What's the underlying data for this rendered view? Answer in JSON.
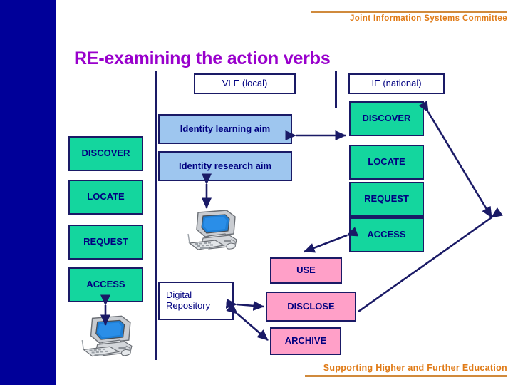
{
  "header": {
    "org": "Joint Information Systems Committee"
  },
  "footer": {
    "tagline": "Supporting Higher and Further Education"
  },
  "slide": {
    "title": "RE-examining the action verbs"
  },
  "columns": {
    "vle_header": "VLE (local)",
    "ie_header": "IE (national)"
  },
  "left_verbs": [
    {
      "label": "DISCOVER"
    },
    {
      "label": "LOCATE"
    },
    {
      "label": "REQUEST"
    },
    {
      "label": "ACCESS"
    }
  ],
  "right_verbs": [
    {
      "label": "DISCOVER"
    },
    {
      "label": "LOCATE"
    },
    {
      "label": "REQUEST"
    },
    {
      "label": "ACCESS"
    }
  ],
  "aims": [
    {
      "label": "Identity learning aim"
    },
    {
      "label": "Identity research aim"
    }
  ],
  "repository": {
    "label": "Digital\nRepository",
    "line1": "Digital",
    "line2": "Repository"
  },
  "pink_verbs": [
    {
      "label": "USE"
    },
    {
      "label": "DISCLOSE"
    },
    {
      "label": "ARCHIVE"
    }
  ],
  "icons": {
    "computer_top": "desktop-computer-icon",
    "computer_bottom": "desktop-computer-icon"
  },
  "colors": {
    "band": "#000099",
    "title": "#9900cc",
    "accent_orange": "#e07b17",
    "rule_orange": "#d08a3c",
    "green_box": "#14d69e",
    "blue_box": "#9ec6ef",
    "pink_box": "#ffa0c8",
    "outline": "#1a1a66",
    "text_navy": "#000080"
  }
}
